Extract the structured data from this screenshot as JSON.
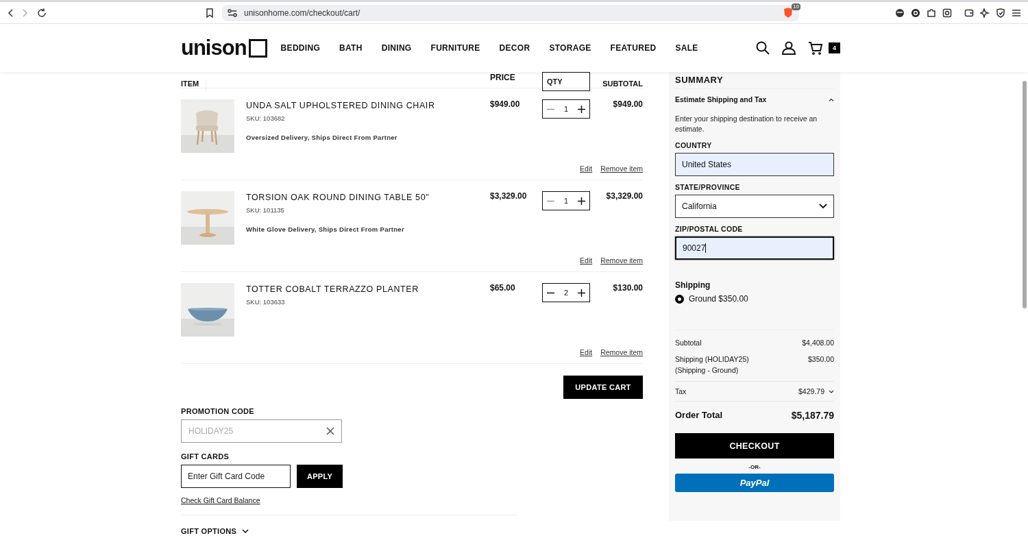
{
  "browser": {
    "url": "unisonhome.com/checkout/cart/",
    "shield_badge": "10"
  },
  "header": {
    "logo": "unison",
    "nav": [
      {
        "label": "BEDDING"
      },
      {
        "label": "BATH"
      },
      {
        "label": "DINING"
      },
      {
        "label": "FURNITURE"
      },
      {
        "label": "DECOR"
      },
      {
        "label": "STORAGE"
      },
      {
        "label": "FEATURED"
      },
      {
        "label": "SALE"
      }
    ],
    "cart_count": "4"
  },
  "cart": {
    "columns": [
      "ITEM",
      "PRICE",
      "QTY",
      "SUBTOTAL"
    ],
    "items": [
      {
        "name": "UNDA SALT UPHOLSTERED DINING CHAIR",
        "sku": "SKU: 103682",
        "note": "Oversized Delivery, Ships Direct From Partner",
        "price": "$949.00",
        "qty": "1",
        "decrease_disabled": true,
        "subtotal": "$949.00",
        "edit": "Edit",
        "remove": "Remove item"
      },
      {
        "name": "TORSION OAK ROUND DINING TABLE 50\"",
        "sku": "SKU: 101135",
        "note": "White Glove Delivery, Ships Direct From Partner",
        "price": "$3,329.00",
        "qty": "1",
        "decrease_disabled": true,
        "subtotal": "$3,329.00",
        "edit": "Edit",
        "remove": "Remove item"
      },
      {
        "name": "TOTTER COBALT TERRAZZO PLANTER",
        "sku": "SKU: 103633",
        "price": "$65.00",
        "qty": "2",
        "decrease_disabled": false,
        "subtotal": "$130.00",
        "edit": "Edit",
        "remove": "Remove item"
      }
    ],
    "update_button": "UPDATE CART",
    "promotion": {
      "label": "PROMOTION CODE",
      "value": "HOLIDAY25",
      "disabled": true
    },
    "gift_cards": {
      "label": "GIFT CARDS",
      "placeholder": "Enter Gift Card Code",
      "apply": "APPLY",
      "balance_link": "Check Gift Card Balance"
    },
    "gift_options": {
      "label": "GIFT OPTIONS",
      "expanded": false
    }
  },
  "summary": {
    "title": "SUMMARY",
    "estimate": {
      "label": "Estimate Shipping and Tax",
      "expanded": true
    },
    "intro": "Enter your shipping destination to receive an estimate.",
    "fields": [
      {
        "kind": "text",
        "label": "COUNTRY",
        "value": "United States",
        "focused": false
      },
      {
        "kind": "select",
        "label": "STATE/PROVINCE",
        "value": "California",
        "focused": false
      },
      {
        "kind": "text",
        "label": "ZIP/POSTAL CODE",
        "value": "90027",
        "focused": true
      }
    ],
    "shipping": {
      "label": "Shipping",
      "options": [
        {
          "label": "Ground $350.00",
          "selected": true
        }
      ]
    },
    "totals": [
      {
        "kind": "line",
        "label": "Subtotal",
        "value": "$4,408.00"
      },
      {
        "kind": "line",
        "label": "Shipping (HOLIDAY25)",
        "sublabel": "(Shipping - Ground)",
        "value": "$350.00"
      },
      {
        "kind": "expandable",
        "label": "Tax",
        "value": "$429.79",
        "expanded": false
      },
      {
        "kind": "total",
        "label": "Order Total",
        "value": "$5,187.79"
      }
    ],
    "checkout": "CHECKOUT",
    "or": "-OR-",
    "paypal": "PayPal"
  }
}
